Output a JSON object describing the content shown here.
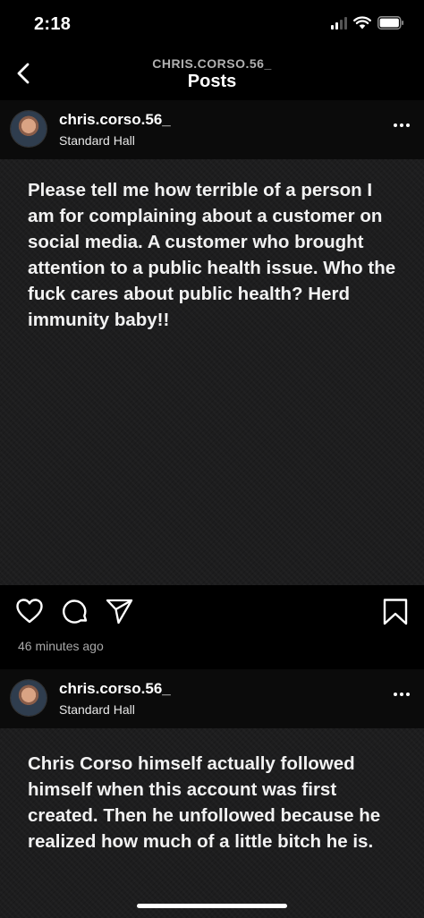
{
  "status_bar": {
    "time": "2:18"
  },
  "nav": {
    "account": "CHRIS.CORSO.56_",
    "title": "Posts"
  },
  "posts": [
    {
      "username": "chris.corso.56_",
      "location": "Standard Hall",
      "text": "Please tell me how terrible of a person I am for complaining about a customer on social media. A customer who brought attention to a public health issue. Who the fuck cares about public health? Herd immunity baby!!",
      "time_ago": "46 minutes ago"
    },
    {
      "username": "chris.corso.56_",
      "location": "Standard Hall",
      "text": "Chris Corso himself actually followed himself when this account was first created. Then he unfollowed because he realized how much of a little bitch he is."
    }
  ],
  "icons": {
    "back": "chevron-left-icon",
    "more": "more-icon",
    "like": "heart-icon",
    "comment": "comment-icon",
    "share": "share-icon",
    "save": "bookmark-icon"
  }
}
